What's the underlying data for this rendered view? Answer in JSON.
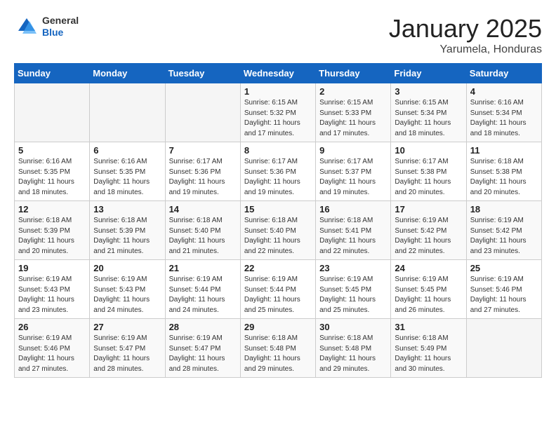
{
  "header": {
    "logo_general": "General",
    "logo_blue": "Blue",
    "title": "January 2025",
    "subtitle": "Yarumela, Honduras"
  },
  "days_of_week": [
    "Sunday",
    "Monday",
    "Tuesday",
    "Wednesday",
    "Thursday",
    "Friday",
    "Saturday"
  ],
  "weeks": [
    [
      {
        "num": "",
        "info": ""
      },
      {
        "num": "",
        "info": ""
      },
      {
        "num": "",
        "info": ""
      },
      {
        "num": "1",
        "info": "Sunrise: 6:15 AM\nSunset: 5:32 PM\nDaylight: 11 hours\nand 17 minutes."
      },
      {
        "num": "2",
        "info": "Sunrise: 6:15 AM\nSunset: 5:33 PM\nDaylight: 11 hours\nand 17 minutes."
      },
      {
        "num": "3",
        "info": "Sunrise: 6:15 AM\nSunset: 5:34 PM\nDaylight: 11 hours\nand 18 minutes."
      },
      {
        "num": "4",
        "info": "Sunrise: 6:16 AM\nSunset: 5:34 PM\nDaylight: 11 hours\nand 18 minutes."
      }
    ],
    [
      {
        "num": "5",
        "info": "Sunrise: 6:16 AM\nSunset: 5:35 PM\nDaylight: 11 hours\nand 18 minutes."
      },
      {
        "num": "6",
        "info": "Sunrise: 6:16 AM\nSunset: 5:35 PM\nDaylight: 11 hours\nand 18 minutes."
      },
      {
        "num": "7",
        "info": "Sunrise: 6:17 AM\nSunset: 5:36 PM\nDaylight: 11 hours\nand 19 minutes."
      },
      {
        "num": "8",
        "info": "Sunrise: 6:17 AM\nSunset: 5:36 PM\nDaylight: 11 hours\nand 19 minutes."
      },
      {
        "num": "9",
        "info": "Sunrise: 6:17 AM\nSunset: 5:37 PM\nDaylight: 11 hours\nand 19 minutes."
      },
      {
        "num": "10",
        "info": "Sunrise: 6:17 AM\nSunset: 5:38 PM\nDaylight: 11 hours\nand 20 minutes."
      },
      {
        "num": "11",
        "info": "Sunrise: 6:18 AM\nSunset: 5:38 PM\nDaylight: 11 hours\nand 20 minutes."
      }
    ],
    [
      {
        "num": "12",
        "info": "Sunrise: 6:18 AM\nSunset: 5:39 PM\nDaylight: 11 hours\nand 20 minutes."
      },
      {
        "num": "13",
        "info": "Sunrise: 6:18 AM\nSunset: 5:39 PM\nDaylight: 11 hours\nand 21 minutes."
      },
      {
        "num": "14",
        "info": "Sunrise: 6:18 AM\nSunset: 5:40 PM\nDaylight: 11 hours\nand 21 minutes."
      },
      {
        "num": "15",
        "info": "Sunrise: 6:18 AM\nSunset: 5:40 PM\nDaylight: 11 hours\nand 22 minutes."
      },
      {
        "num": "16",
        "info": "Sunrise: 6:18 AM\nSunset: 5:41 PM\nDaylight: 11 hours\nand 22 minutes."
      },
      {
        "num": "17",
        "info": "Sunrise: 6:19 AM\nSunset: 5:42 PM\nDaylight: 11 hours\nand 22 minutes."
      },
      {
        "num": "18",
        "info": "Sunrise: 6:19 AM\nSunset: 5:42 PM\nDaylight: 11 hours\nand 23 minutes."
      }
    ],
    [
      {
        "num": "19",
        "info": "Sunrise: 6:19 AM\nSunset: 5:43 PM\nDaylight: 11 hours\nand 23 minutes."
      },
      {
        "num": "20",
        "info": "Sunrise: 6:19 AM\nSunset: 5:43 PM\nDaylight: 11 hours\nand 24 minutes."
      },
      {
        "num": "21",
        "info": "Sunrise: 6:19 AM\nSunset: 5:44 PM\nDaylight: 11 hours\nand 24 minutes."
      },
      {
        "num": "22",
        "info": "Sunrise: 6:19 AM\nSunset: 5:44 PM\nDaylight: 11 hours\nand 25 minutes."
      },
      {
        "num": "23",
        "info": "Sunrise: 6:19 AM\nSunset: 5:45 PM\nDaylight: 11 hours\nand 25 minutes."
      },
      {
        "num": "24",
        "info": "Sunrise: 6:19 AM\nSunset: 5:45 PM\nDaylight: 11 hours\nand 26 minutes."
      },
      {
        "num": "25",
        "info": "Sunrise: 6:19 AM\nSunset: 5:46 PM\nDaylight: 11 hours\nand 27 minutes."
      }
    ],
    [
      {
        "num": "26",
        "info": "Sunrise: 6:19 AM\nSunset: 5:46 PM\nDaylight: 11 hours\nand 27 minutes."
      },
      {
        "num": "27",
        "info": "Sunrise: 6:19 AM\nSunset: 5:47 PM\nDaylight: 11 hours\nand 28 minutes."
      },
      {
        "num": "28",
        "info": "Sunrise: 6:19 AM\nSunset: 5:47 PM\nDaylight: 11 hours\nand 28 minutes."
      },
      {
        "num": "29",
        "info": "Sunrise: 6:18 AM\nSunset: 5:48 PM\nDaylight: 11 hours\nand 29 minutes."
      },
      {
        "num": "30",
        "info": "Sunrise: 6:18 AM\nSunset: 5:48 PM\nDaylight: 11 hours\nand 29 minutes."
      },
      {
        "num": "31",
        "info": "Sunrise: 6:18 AM\nSunset: 5:49 PM\nDaylight: 11 hours\nand 30 minutes."
      },
      {
        "num": "",
        "info": ""
      }
    ]
  ]
}
